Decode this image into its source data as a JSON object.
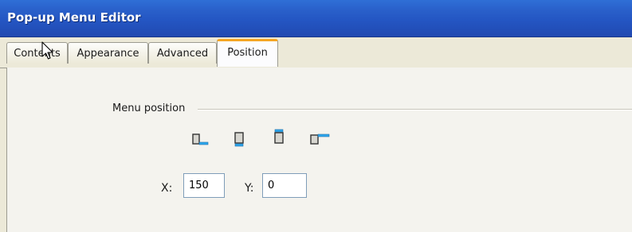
{
  "window": {
    "title": "Pop-up Menu Editor"
  },
  "tabs": [
    {
      "label": "Contents",
      "selected": false
    },
    {
      "label": "Appearance",
      "selected": false
    },
    {
      "label": "Advanced",
      "selected": false
    },
    {
      "label": "Position",
      "selected": true
    }
  ],
  "position": {
    "group_label": "Menu position",
    "icons": [
      "position-bottom-right-icon",
      "position-bottom-icon",
      "position-top-icon",
      "position-top-right-icon"
    ],
    "x_label": "X:",
    "x_value": "150",
    "y_label": "Y:",
    "y_value": "0"
  },
  "colors": {
    "title_bar": "#2456c3",
    "tab_highlight": "#f5a623",
    "position_marker": "#2ea8ee"
  }
}
